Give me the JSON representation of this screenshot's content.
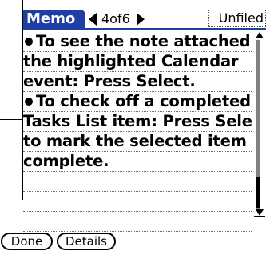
{
  "header": {
    "title": "Memo",
    "record_position": "4of6",
    "category": "Unfiled"
  },
  "note_lines": [
    {
      "text": "To see the note attached to",
      "bullet": true
    },
    {
      "text": "the highlighted Calendar",
      "bullet": false
    },
    {
      "text": "event: Press Select.",
      "bullet": false
    },
    {
      "text": "To check off a completed",
      "bullet": true
    },
    {
      "text": "Tasks List item: Press Select",
      "bullet": false
    },
    {
      "text": "to mark the selected item as",
      "bullet": false
    },
    {
      "text": "complete.",
      "bullet": false
    },
    {
      "text": "",
      "bullet": false
    },
    {
      "text": "",
      "bullet": false
    },
    {
      "text": "",
      "bullet": false
    }
  ],
  "buttons": {
    "done": "Done",
    "details": "Details"
  },
  "colors": {
    "header_accent": "#1f3fa6"
  },
  "icons": {
    "prev_record": "left-arrow-icon",
    "next_record": "right-arrow-icon",
    "scroll_up": "scroll-up-arrow-icon",
    "scroll_down": "scroll-down-arrow-icon"
  }
}
